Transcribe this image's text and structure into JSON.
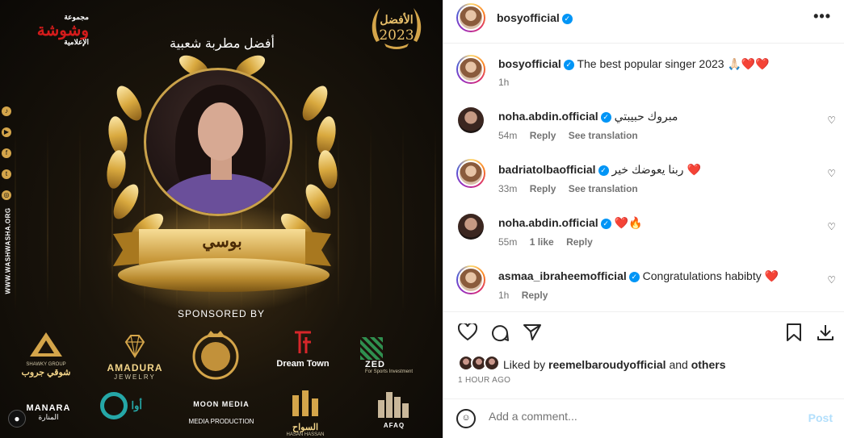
{
  "image": {
    "brand": {
      "top": "مجموعة",
      "main": "وشوشة",
      "tail": "الإعلامية"
    },
    "badge": {
      "label": "الأفضل",
      "year": "2023"
    },
    "award_title": "أفضل مطربة شعبية",
    "winner_name": "بوسي",
    "website": "WWW.WASHWASHA.ORG",
    "sponsored_label": "SPONSORED BY",
    "sponsors": [
      {
        "name": "SHAWKY GROUP",
        "sub": "شوقي جروب"
      },
      {
        "name": "AMADURA",
        "sub": "JEWELRY"
      },
      {
        "name": "",
        "sub": ""
      },
      {
        "name": "Dream Town",
        "sub": ""
      },
      {
        "name": "ZED",
        "sub": "For Sports Investment"
      },
      {
        "name": "MANARA",
        "sub": "المنارة"
      },
      {
        "name": "أوا",
        "sub": ""
      },
      {
        "name": "MOON MEDIA",
        "sub": "MEDIA PRODUCTION"
      },
      {
        "name": "السواح",
        "sub": "HASAN HASSAN"
      },
      {
        "name": "AFAQ",
        "sub": ""
      }
    ]
  },
  "header": {
    "username": "bosyofficial",
    "more": "•••"
  },
  "caption": {
    "username": "bosyofficial",
    "text": "The best popular singer 2023 🙏🏻❤️❤️",
    "time": "1h"
  },
  "comments": [
    {
      "username": "noha.abdin.official",
      "text": "مبروك حبيبتي",
      "time": "54m",
      "actions": [
        "Reply",
        "See translation"
      ]
    },
    {
      "username": "badriatolbaofficial",
      "text": "ربنا يعوضك خير ❤️",
      "time": "33m",
      "actions": [
        "Reply",
        "See translation"
      ]
    },
    {
      "username": "noha.abdin.official",
      "text": "❤️🔥",
      "time": "55m",
      "actions": [
        "1 like",
        "Reply"
      ]
    },
    {
      "username": "asmaa_ibraheemofficial",
      "text": "Congratulations habibty ❤️",
      "time": "1h",
      "actions": [
        "Reply"
      ]
    }
  ],
  "likes": {
    "prefix": "Liked by",
    "user": "reemelbaroudyofficial",
    "and": "and",
    "others": "others"
  },
  "timestamp": "1 HOUR AGO",
  "comment_box": {
    "placeholder": "Add a comment...",
    "post_label": "Post"
  },
  "colors": {
    "accent": "#0095f6",
    "gold": "#d4a54a",
    "post_disabled": "#b2dffc"
  }
}
